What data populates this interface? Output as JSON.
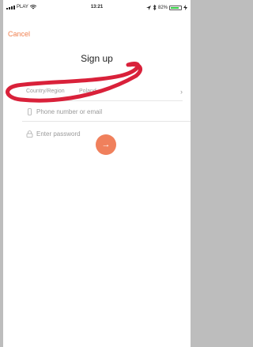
{
  "status": {
    "carrier": "PLAY",
    "time": "13:21",
    "battery": "82%"
  },
  "nav": {
    "cancel": "Cancel"
  },
  "title": "Sign up",
  "form": {
    "country_label": "Country/Region",
    "country_value": "Poland",
    "phone_placeholder": "Phone number or email",
    "password_placeholder": "Enter password"
  },
  "icons": {
    "chevron": "chevron-right-icon",
    "lock": "lock-icon",
    "arrow": "arrow-right-icon"
  },
  "colors": {
    "accent": "#f07f4e",
    "button": "#f0805c",
    "scribble": "#d9213a"
  }
}
